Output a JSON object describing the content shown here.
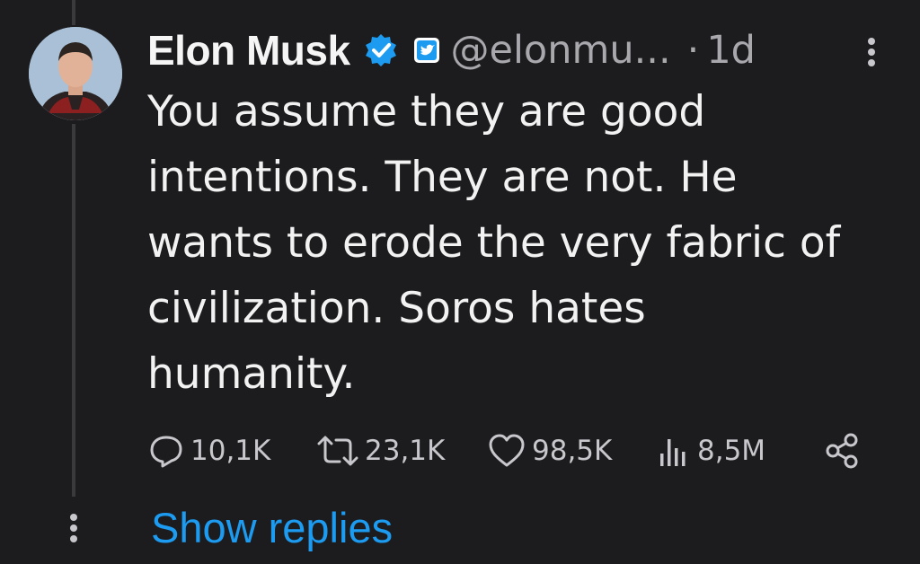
{
  "author": {
    "name": "Elon Musk",
    "handle": "@elonmu...",
    "separator": "·",
    "time": "1d"
  },
  "tweet": {
    "lines": [
      "You assume they are good",
      "intentions. They are not. He",
      "wants to erode the very fabric of",
      "civilization. Soros hates",
      "humanity."
    ]
  },
  "stats": {
    "replies": "10,1K",
    "retweets": "23,1K",
    "likes": "98,5K",
    "views": "8,5M"
  },
  "show_replies_label": "Show replies",
  "colors": {
    "accent": "#1d9bf0",
    "background": "#1c1c1e"
  },
  "icons": [
    "verified-badge-icon",
    "affiliate-badge-icon",
    "more-options-icon",
    "reply-icon",
    "retweet-icon",
    "like-icon",
    "views-icon",
    "share-icon",
    "thread-more-icon"
  ]
}
